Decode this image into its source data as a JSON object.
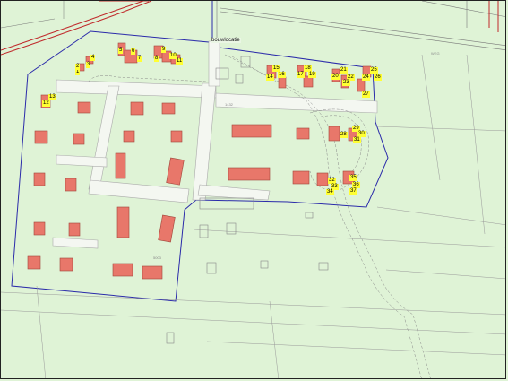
{
  "map": {
    "location_label": "bouwlocatie",
    "colors": {
      "background": "#dff3d6",
      "building_fill": "#e8776a",
      "building_stroke": "#a0453a",
      "boundary": "#2b2baa",
      "label_bg": "#ffff33",
      "road_red": "#c0292b",
      "pale": "#f2f6ef"
    },
    "lot_numbers": [
      "1",
      "2",
      "3",
      "4",
      "5",
      "6",
      "7",
      "8",
      "9",
      "10",
      "11",
      "12",
      "13",
      "14",
      "15",
      "16",
      "17",
      "18",
      "19",
      "20",
      "21",
      "22",
      "23",
      "24",
      "25",
      "26",
      "27",
      "28",
      "29",
      "30",
      "31",
      "32",
      "33",
      "34",
      "35",
      "36",
      "37"
    ]
  }
}
